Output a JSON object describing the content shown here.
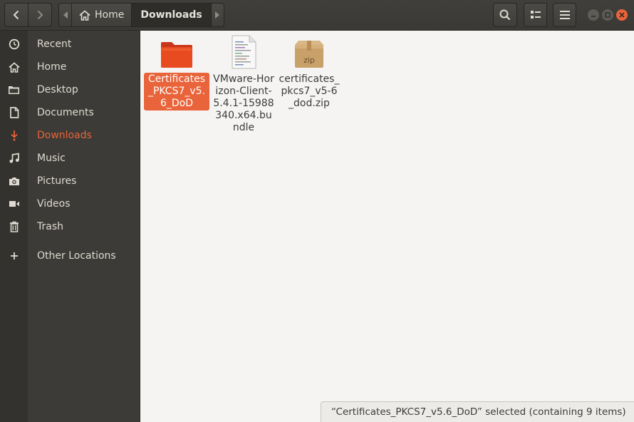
{
  "window": {
    "title": "Downloads"
  },
  "toolbar": {
    "back": "back",
    "forward": "forward",
    "breadcrumb": [
      {
        "label": "Home",
        "icon": "home-icon"
      },
      {
        "label": "Downloads"
      }
    ],
    "search": "search-icon",
    "view": "list-view-icon",
    "menu": "hamburger-menu-icon"
  },
  "sidebar": {
    "items": [
      {
        "label": "Recent",
        "icon": "clock-icon"
      },
      {
        "label": "Home",
        "icon": "home-icon"
      },
      {
        "label": "Desktop",
        "icon": "folder-icon"
      },
      {
        "label": "Documents",
        "icon": "document-icon"
      },
      {
        "label": "Downloads",
        "icon": "download-icon",
        "active": true
      },
      {
        "label": "Music",
        "icon": "music-icon"
      },
      {
        "label": "Pictures",
        "icon": "camera-icon"
      },
      {
        "label": "Videos",
        "icon": "video-icon"
      },
      {
        "label": "Trash",
        "icon": "trash-icon"
      },
      {
        "label": "Other Locations",
        "icon": "plus-icon"
      }
    ]
  },
  "files": [
    {
      "name": "Certificates_PKCS7_v5.6_DoD",
      "type": "folder",
      "selected": true
    },
    {
      "name": "VMware-Horizon-Client-5.4.1-15988340.x64.bundle",
      "type": "text"
    },
    {
      "name": "certificates_pkcs7_v5-6_dod.zip",
      "type": "zip",
      "icon_label": "zip"
    }
  ],
  "status": {
    "text": "“Certificates_PKCS7_v5.6_DoD” selected  (containing 9 items)"
  },
  "colors": {
    "accent": "#e9643a",
    "sidebar": "#3c3b37",
    "header": "#3d3c38"
  }
}
